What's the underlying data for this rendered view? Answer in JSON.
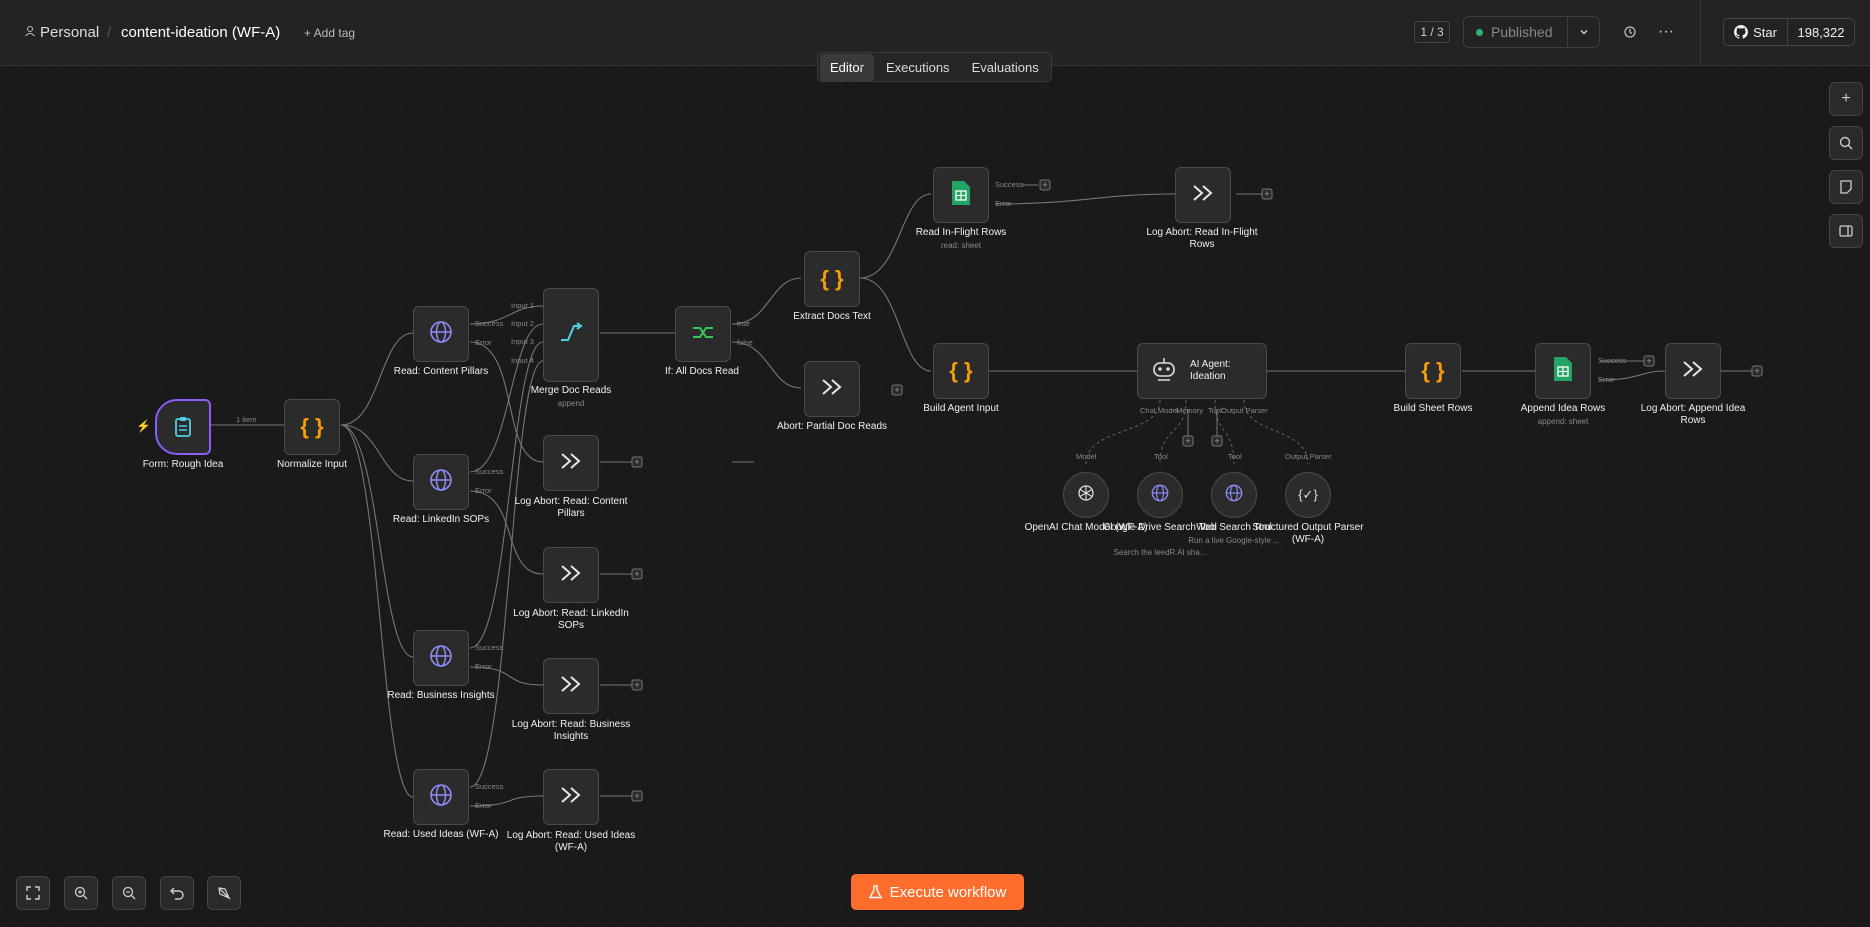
{
  "header": {
    "workspace": "Personal",
    "workflow_name": "content-ideation (WF-A)",
    "add_tag": "+ Add tag",
    "version_counter": "1 / 3",
    "published_label": "Published",
    "star_label": "Star",
    "star_count": "198,322"
  },
  "tabs": [
    "Editor",
    "Executions",
    "Evaluations"
  ],
  "execute_label": "Execute workflow",
  "connection_label": "1 item",
  "nodes": {
    "form": "Form: Rough Idea",
    "normalize": "Normalize Input",
    "read_pillars": "Read: Content Pillars",
    "read_linkedin": "Read: LinkedIn SOPs",
    "read_business": "Read: Business Insights",
    "read_used": "Read: Used Ideas (WF-A)",
    "merge": "Merge Doc Reads",
    "merge_sub": "append",
    "if": "If: All Docs Read",
    "extract": "Extract Docs Text",
    "abort_partial": "Abort: Partial Doc Reads",
    "read_inflight": "Read In-Flight Rows",
    "read_inflight_sub": "read: sheet",
    "log_inflight": "Log Abort: Read In-Flight Rows",
    "log_pillars": "Log Abort: Read: Content Pillars",
    "log_linkedin": "Log Abort: Read: LinkedIn SOPs",
    "log_business": "Log Abort: Read: Business Insights",
    "log_used": "Log Abort: Read: Used Ideas (WF-A)",
    "build_agent": "Build Agent Input",
    "agent": "AI Agent: Ideation",
    "build_sheet": "Build Sheet Rows",
    "append": "Append Idea Rows",
    "append_sub": "append: sheet",
    "log_append": "Log Abort: Append Idea Rows",
    "openai": "OpenAI Chat Model (WF-A)",
    "gdrive": "Google Drive Search Tool",
    "gdrive_sub": "Search the leedR AI sha...",
    "websearch": "Web Search Tool",
    "websearch_sub": "Run a live Google-style ...",
    "parser": "Structured Output Parser (WF-A)"
  },
  "ports": {
    "success": "Success",
    "error": "Error",
    "true": "true",
    "false": "false",
    "input1": "Input 1",
    "input2": "Input 2",
    "input3": "Input 3",
    "input4": "Input 4",
    "chat_model": "Chat Model",
    "memory": "Memory",
    "tool": "Tool",
    "output_parser": "Output Parser",
    "model": "Model"
  },
  "colors": {
    "accent": "#ff6d2d",
    "trigger_border": "#8b5cf6",
    "code": "#f59e0b",
    "http": "#8b8cf6",
    "sheets": "#21a464",
    "if": "#34c759",
    "merge": "#4fd1e6"
  }
}
